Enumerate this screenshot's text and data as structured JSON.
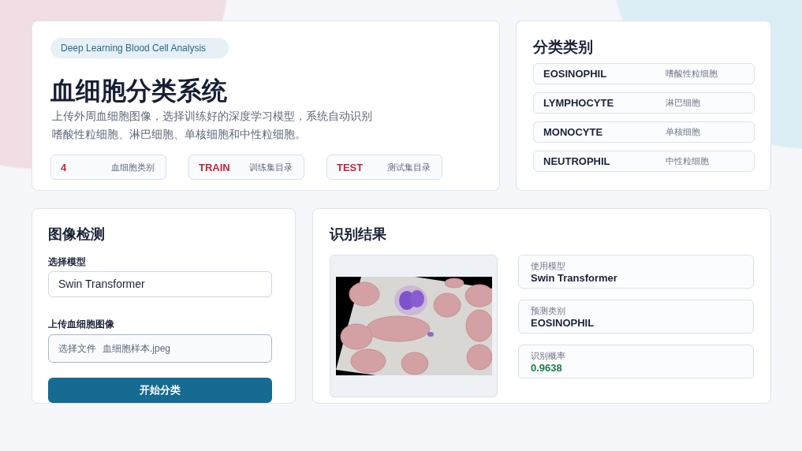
{
  "hero": {
    "badge": "Deep Learning Blood Cell Analysis",
    "title": "血细胞分类系统",
    "description": "上传外周血细胞图像，选择训练好的深度学习模型，系统自动识别嗜酸性粒细胞、淋巴细胞、单核细胞和中性粒细胞。",
    "stats": [
      {
        "value": "4",
        "label": "血细胞类别"
      },
      {
        "value": "TRAIN",
        "label": "训练集目录"
      },
      {
        "value": "TEST",
        "label": "测试集目录"
      }
    ]
  },
  "categories": {
    "title": "分类类别",
    "items": [
      {
        "code": "EOSINOPHIL",
        "name": "嗜酸性粒细胞"
      },
      {
        "code": "LYMPHOCYTE",
        "name": "淋巴细胞"
      },
      {
        "code": "MONOCYTE",
        "name": "单核细胞"
      },
      {
        "code": "NEUTROPHIL",
        "name": "中性粒细胞"
      }
    ]
  },
  "detection": {
    "title": "图像检测",
    "model_label": "选择模型",
    "model_field": {
      "value": "Swin Transformer"
    },
    "upload_label": "上传血细胞图像",
    "file_field": {
      "button": "选择文件",
      "file_name": "血细胞样本.jpeg"
    },
    "submit_button": "开始分类"
  },
  "result": {
    "title": "识别结果",
    "fields": [
      {
        "label": "使用模型",
        "value": "Swin Transformer",
        "kind": "text"
      },
      {
        "label": "预测类别",
        "value": "EOSINOPHIL",
        "kind": "text"
      },
      {
        "label": "识别概率",
        "value": "0.9638",
        "kind": "score"
      }
    ]
  }
}
